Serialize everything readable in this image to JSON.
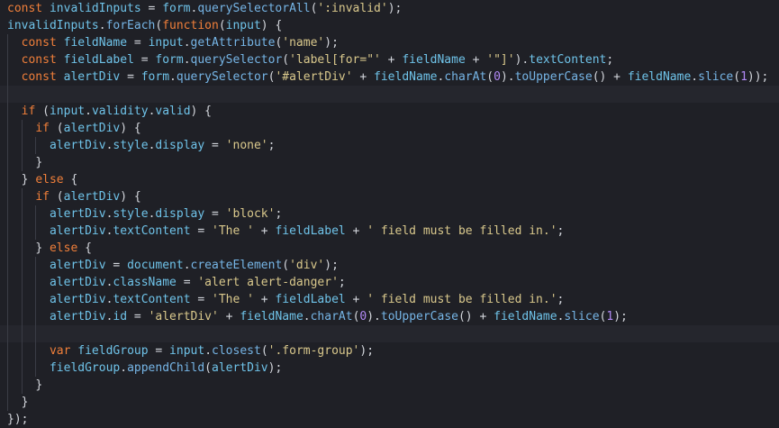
{
  "editor": {
    "lines": [
      {
        "indent": 0,
        "tokens": [
          [
            "kw",
            "const "
          ],
          [
            "var",
            "invalidInputs"
          ],
          [
            "pun",
            " = "
          ],
          [
            "var",
            "form"
          ],
          [
            "pun",
            "."
          ],
          [
            "fn",
            "querySelectorAll"
          ],
          [
            "pun",
            "("
          ],
          [
            "str",
            "':invalid'"
          ],
          [
            "pun",
            ");"
          ]
        ]
      },
      {
        "indent": 0,
        "tokens": [
          [
            "var",
            "invalidInputs"
          ],
          [
            "pun",
            "."
          ],
          [
            "fn",
            "forEach"
          ],
          [
            "pun",
            "("
          ],
          [
            "kw",
            "function"
          ],
          [
            "pun",
            "("
          ],
          [
            "var",
            "input"
          ],
          [
            "pun",
            ") {"
          ]
        ]
      },
      {
        "indent": 1,
        "tokens": [
          [
            "kw",
            "const "
          ],
          [
            "var",
            "fieldName"
          ],
          [
            "pun",
            " = "
          ],
          [
            "var",
            "input"
          ],
          [
            "pun",
            "."
          ],
          [
            "fn",
            "getAttribute"
          ],
          [
            "pun",
            "("
          ],
          [
            "str",
            "'name'"
          ],
          [
            "pun",
            ");"
          ]
        ]
      },
      {
        "indent": 1,
        "tokens": [
          [
            "kw",
            "const "
          ],
          [
            "var",
            "fieldLabel"
          ],
          [
            "pun",
            " = "
          ],
          [
            "var",
            "form"
          ],
          [
            "pun",
            "."
          ],
          [
            "fn",
            "querySelector"
          ],
          [
            "pun",
            "("
          ],
          [
            "str",
            "'label[for=\"'"
          ],
          [
            "pun",
            " + "
          ],
          [
            "var",
            "fieldName"
          ],
          [
            "pun",
            " + "
          ],
          [
            "str",
            "'\"]'"
          ],
          [
            "pun",
            ")."
          ],
          [
            "var",
            "textContent"
          ],
          [
            "pun",
            ";"
          ]
        ]
      },
      {
        "indent": 1,
        "tokens": [
          [
            "kw",
            "const "
          ],
          [
            "var",
            "alertDiv"
          ],
          [
            "pun",
            " = "
          ],
          [
            "var",
            "form"
          ],
          [
            "pun",
            "."
          ],
          [
            "fn",
            "querySelector"
          ],
          [
            "pun",
            "("
          ],
          [
            "str",
            "'#alertDiv'"
          ],
          [
            "pun",
            " + "
          ],
          [
            "var",
            "fieldName"
          ],
          [
            "pun",
            "."
          ],
          [
            "fn",
            "charAt"
          ],
          [
            "pun",
            "("
          ],
          [
            "bool",
            "0"
          ],
          [
            "pun",
            ")."
          ],
          [
            "fn",
            "toUpperCase"
          ],
          [
            "pun",
            "() + "
          ],
          [
            "var",
            "fieldName"
          ],
          [
            "pun",
            "."
          ],
          [
            "fn",
            "slice"
          ],
          [
            "pun",
            "("
          ],
          [
            "bool",
            "1"
          ],
          [
            "pun",
            "));"
          ]
        ]
      },
      {
        "indent": 1,
        "tokens": [],
        "highlight": true
      },
      {
        "indent": 1,
        "tokens": [
          [
            "kw",
            "if "
          ],
          [
            "pun",
            "("
          ],
          [
            "var",
            "input"
          ],
          [
            "pun",
            "."
          ],
          [
            "var",
            "validity"
          ],
          [
            "pun",
            "."
          ],
          [
            "var",
            "valid"
          ],
          [
            "pun",
            ") {"
          ]
        ]
      },
      {
        "indent": 2,
        "tokens": [
          [
            "kw",
            "if "
          ],
          [
            "pun",
            "("
          ],
          [
            "var",
            "alertDiv"
          ],
          [
            "pun",
            ") {"
          ]
        ]
      },
      {
        "indent": 3,
        "tokens": [
          [
            "var",
            "alertDiv"
          ],
          [
            "pun",
            "."
          ],
          [
            "var",
            "style"
          ],
          [
            "pun",
            "."
          ],
          [
            "var",
            "display"
          ],
          [
            "pun",
            " = "
          ],
          [
            "str",
            "'none'"
          ],
          [
            "pun",
            ";"
          ]
        ]
      },
      {
        "indent": 2,
        "tokens": [
          [
            "pun",
            "}"
          ]
        ]
      },
      {
        "indent": 1,
        "tokens": [
          [
            "pun",
            "} "
          ],
          [
            "kw",
            "else"
          ],
          [
            "pun",
            " {"
          ]
        ]
      },
      {
        "indent": 2,
        "tokens": [
          [
            "kw",
            "if "
          ],
          [
            "pun",
            "("
          ],
          [
            "var",
            "alertDiv"
          ],
          [
            "pun",
            ") {"
          ]
        ]
      },
      {
        "indent": 3,
        "tokens": [
          [
            "var",
            "alertDiv"
          ],
          [
            "pun",
            "."
          ],
          [
            "var",
            "style"
          ],
          [
            "pun",
            "."
          ],
          [
            "var",
            "display"
          ],
          [
            "pun",
            " = "
          ],
          [
            "str",
            "'block'"
          ],
          [
            "pun",
            ";"
          ]
        ]
      },
      {
        "indent": 3,
        "tokens": [
          [
            "var",
            "alertDiv"
          ],
          [
            "pun",
            "."
          ],
          [
            "var",
            "textContent"
          ],
          [
            "pun",
            " = "
          ],
          [
            "str",
            "'The '"
          ],
          [
            "pun",
            " + "
          ],
          [
            "var",
            "fieldLabel"
          ],
          [
            "pun",
            " + "
          ],
          [
            "str",
            "' field must be filled in.'"
          ],
          [
            "pun",
            ";"
          ]
        ]
      },
      {
        "indent": 2,
        "tokens": [
          [
            "pun",
            "} "
          ],
          [
            "kw",
            "else"
          ],
          [
            "pun",
            " {"
          ]
        ]
      },
      {
        "indent": 3,
        "tokens": [
          [
            "var",
            "alertDiv"
          ],
          [
            "pun",
            " = "
          ],
          [
            "var",
            "document"
          ],
          [
            "pun",
            "."
          ],
          [
            "fn",
            "createElement"
          ],
          [
            "pun",
            "("
          ],
          [
            "str",
            "'div'"
          ],
          [
            "pun",
            ");"
          ]
        ]
      },
      {
        "indent": 3,
        "tokens": [
          [
            "var",
            "alertDiv"
          ],
          [
            "pun",
            "."
          ],
          [
            "var",
            "className"
          ],
          [
            "pun",
            " = "
          ],
          [
            "str",
            "'alert alert-danger'"
          ],
          [
            "pun",
            ";"
          ]
        ]
      },
      {
        "indent": 3,
        "tokens": [
          [
            "var",
            "alertDiv"
          ],
          [
            "pun",
            "."
          ],
          [
            "var",
            "textContent"
          ],
          [
            "pun",
            " = "
          ],
          [
            "str",
            "'The '"
          ],
          [
            "pun",
            " + "
          ],
          [
            "var",
            "fieldLabel"
          ],
          [
            "pun",
            " + "
          ],
          [
            "str",
            "' field must be filled in.'"
          ],
          [
            "pun",
            ";"
          ]
        ]
      },
      {
        "indent": 3,
        "tokens": [
          [
            "var",
            "alertDiv"
          ],
          [
            "pun",
            "."
          ],
          [
            "var",
            "id"
          ],
          [
            "pun",
            " = "
          ],
          [
            "str",
            "'alertDiv'"
          ],
          [
            "pun",
            " + "
          ],
          [
            "var",
            "fieldName"
          ],
          [
            "pun",
            "."
          ],
          [
            "fn",
            "charAt"
          ],
          [
            "pun",
            "("
          ],
          [
            "bool",
            "0"
          ],
          [
            "pun",
            ")."
          ],
          [
            "fn",
            "toUpperCase"
          ],
          [
            "pun",
            "() + "
          ],
          [
            "var",
            "fieldName"
          ],
          [
            "pun",
            "."
          ],
          [
            "fn",
            "slice"
          ],
          [
            "pun",
            "("
          ],
          [
            "bool",
            "1"
          ],
          [
            "pun",
            ");"
          ]
        ]
      },
      {
        "indent": 3,
        "tokens": [],
        "highlight": true
      },
      {
        "indent": 3,
        "tokens": [
          [
            "kw",
            "var "
          ],
          [
            "var",
            "fieldGroup"
          ],
          [
            "pun",
            " = "
          ],
          [
            "var",
            "input"
          ],
          [
            "pun",
            "."
          ],
          [
            "fn",
            "closest"
          ],
          [
            "pun",
            "("
          ],
          [
            "str",
            "'.form-group'"
          ],
          [
            "pun",
            ");"
          ]
        ]
      },
      {
        "indent": 3,
        "tokens": [
          [
            "var",
            "fieldGroup"
          ],
          [
            "pun",
            "."
          ],
          [
            "fn",
            "appendChild"
          ],
          [
            "pun",
            "("
          ],
          [
            "var",
            "alertDiv"
          ],
          [
            "pun",
            ");"
          ]
        ]
      },
      {
        "indent": 2,
        "tokens": [
          [
            "pun",
            "}"
          ]
        ]
      },
      {
        "indent": 1,
        "tokens": [
          [
            "pun",
            "}"
          ]
        ]
      },
      {
        "indent": 0,
        "tokens": [
          [
            "pun",
            "});"
          ]
        ]
      }
    ],
    "colors": {
      "background": "#1f2026",
      "keyword": "#f07f3a",
      "identifier": "#6fc3e9",
      "function": "#76b5e6",
      "string": "#d9c88c",
      "number": "#b189f5",
      "punctuation": "#d3d6dc"
    }
  }
}
